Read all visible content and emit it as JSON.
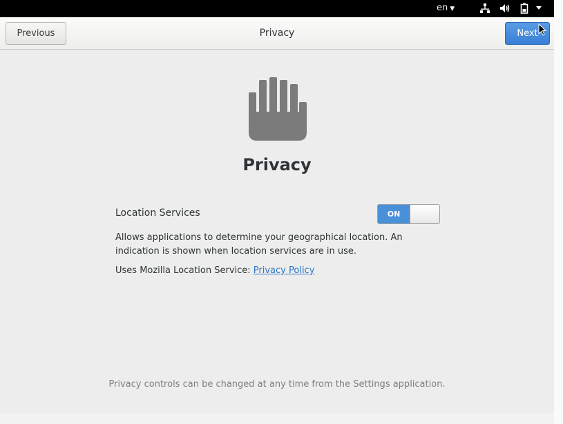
{
  "topbar": {
    "language": "en",
    "icons": [
      "chevron-down-icon",
      "network-icon",
      "volume-icon",
      "battery-icon",
      "chevron-down-icon"
    ]
  },
  "header": {
    "previous_label": "Previous",
    "title": "Privacy",
    "next_label": "Next"
  },
  "page": {
    "hero_icon": "hand-icon",
    "heading": "Privacy",
    "location_services": {
      "label": "Location Services",
      "toggle_state": "ON",
      "description": "Allows applications to determine your geographical location. An indication is shown when location services are in use.",
      "uses_text": "Uses Mozilla Location Service: ",
      "policy_link": "Privacy Policy"
    },
    "footer_note": "Privacy controls can be changed at any time from the Settings application."
  },
  "colors": {
    "accent": "#4a90d9",
    "link": "#2a76c6",
    "icon_gray": "#7b7b7b"
  }
}
